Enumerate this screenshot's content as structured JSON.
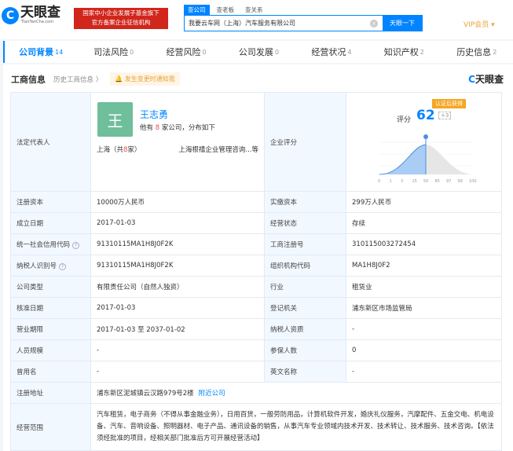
{
  "header": {
    "logo_text": "天眼查",
    "logo_sub": "TianYanCha.com",
    "badge_line1": "国家中小企业发展子基金旗下",
    "badge_line2": "官方备案企业征信机构",
    "search_tabs": [
      "查公司",
      "查老板",
      "查关系"
    ],
    "search_value": "我要云车网（上海）汽车服务有限公司",
    "search_button": "天眼一下",
    "vip": "VIP会员 ▾"
  },
  "nav": [
    {
      "label": "公司背景",
      "count": "14"
    },
    {
      "label": "司法风险",
      "count": "0"
    },
    {
      "label": "经营风险",
      "count": "0"
    },
    {
      "label": "公司发展",
      "count": "0"
    },
    {
      "label": "经营状况",
      "count": "4"
    },
    {
      "label": "知识产权",
      "count": "2"
    },
    {
      "label": "历史信息",
      "count": "2"
    }
  ],
  "section": {
    "title": "工商信息",
    "history": "历史工商信息 〉",
    "notice": "🔔 发生变更时通知我",
    "brand": "天眼查"
  },
  "rep": {
    "label": "法定代表人",
    "avatar": "王",
    "name": "王志勇",
    "sub_pre": "他有 ",
    "count": "8",
    "sub_post": " 家公司，分布如下",
    "loc_pre": "上海（共",
    "loc_count": "8",
    "loc_post": "家）",
    "company": "上海根禧企业管理咨询...等"
  },
  "score": {
    "label": "企业评分",
    "cert": "认证后获得",
    "score_label": "评分",
    "value": "62",
    "plus": "+3",
    "ticks": [
      "0",
      "1",
      "3",
      "15",
      "50",
      "85",
      "97",
      "99",
      "100"
    ],
    "percent_marker": 50
  },
  "rows": [
    [
      "注册资本",
      "10000万人民币",
      "实缴资本",
      "299万人民币"
    ],
    [
      "成立日期",
      "2017-01-03",
      "经营状态",
      "存续"
    ],
    [
      "统一社会信用代码",
      "91310115MA1H8J0F2K",
      "工商注册号",
      "310115003272454"
    ],
    [
      "纳税人识别号",
      "91310115MA1H8J0F2K",
      "组织机构代码",
      "MA1H8J0F2"
    ],
    [
      "公司类型",
      "有限责任公司（自然人独资）",
      "行业",
      "租赁业"
    ],
    [
      "核准日期",
      "2017-01-03",
      "登记机关",
      "浦东新区市场监管局"
    ],
    [
      "营业期限",
      "2017-01-03 至 2037-01-02",
      "纳税人资质",
      "-"
    ],
    [
      "人员规模",
      "-",
      "参保人数",
      "0"
    ],
    [
      "曾用名",
      "-",
      "英文名称",
      "-"
    ]
  ],
  "address": {
    "label": "注册地址",
    "value": "浦东新区泥城镇云汉路979号2楼",
    "link": "附近公司"
  },
  "scope": {
    "label": "经营范围",
    "value": "汽车租赁，电子商务（不得从事金融业务），日用百货，一般劳防用品，计算机软件开发，婚庆礼仪服务，汽摩配件、五金交电、机电设备、汽车、音响设备、照明器材、电子产品、通讯设备的销售，从事汽车专业领域内技术开发、技术转让、技术服务、技术咨询。【依法须经批准的项目，经相关部门批准后方可开展经营活动】"
  }
}
